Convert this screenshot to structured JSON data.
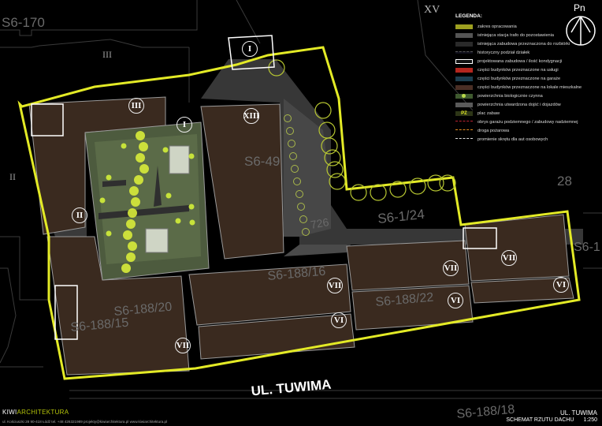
{
  "plan": {
    "street_name": "UL. TUWIMA",
    "parcel_labels": [
      "S6-170",
      "S6-49",
      "S6-1/24",
      "S6-188/16",
      "S6-188/20",
      "S6-188/15",
      "S6-188/22",
      "S6-188/18"
    ],
    "parcel_small_labels": [
      "28",
      "726",
      "S6-1"
    ],
    "roman_plain": [
      "III",
      "II",
      "XV"
    ],
    "roman_circled": [
      "I",
      "III",
      "I",
      "XIII",
      "II",
      "VII",
      "VII",
      "VI",
      "VII",
      "VI",
      "VI",
      "VII"
    ],
    "colors": {
      "scope": "#e3ea26",
      "residential": "#3a2a1f",
      "bio_active": "#54633d",
      "paved": "#6e6e6e",
      "existing_build": "#2e2e2e"
    }
  },
  "compass": {
    "label": "Pn"
  },
  "legend": {
    "title": "LEGENDA:",
    "items": [
      {
        "label": "zakres opracowania",
        "swatch": "#9ea020",
        "icon": ""
      },
      {
        "label": "istniejąca stacja trafo do pozostawienia",
        "swatch": "#555555",
        "icon": ""
      },
      {
        "label": "istniejąca zabudowa przeznaczona do rozbiórki",
        "swatch": "#2a2a2a",
        "icon": ""
      },
      {
        "label": "historyczny podział działek",
        "swatch": "#0f0f1a",
        "icon": "dashed-line"
      },
      {
        "label": "projektowana zabudowa / ilość kondygnacji",
        "swatch": "#111111",
        "icon": "outline"
      },
      {
        "label": "części budynków przeznaczone na usługi",
        "swatch": "#b3261e",
        "icon": ""
      },
      {
        "label": "części budynków przeznaczone na garaże",
        "swatch": "#1c3d4e",
        "icon": ""
      },
      {
        "label": "części budynków przeznaczone na lokale mieszkalne",
        "swatch": "#4a2f25",
        "icon": ""
      },
      {
        "label": "powierzchnia biologicznie czynna",
        "swatch": "#3f5a2f",
        "icon": "dot"
      },
      {
        "label": "powierzchnia utwardzona dojść i dojazdów",
        "swatch": "#5a5a5a",
        "icon": ""
      },
      {
        "label": "plac zabaw",
        "swatch": "#2d3516",
        "icon": "text-PZ"
      },
      {
        "label": "obrys garażu podziemnego / zabudowy nadziemnej",
        "swatch": "#111111",
        "icon": "red-dash"
      },
      {
        "label": "droga pożarowa",
        "swatch": "#111111",
        "icon": "orange-dash"
      },
      {
        "label": "promienie skrętu dla aut osobowych",
        "swatch": "#111111",
        "icon": "white-dash"
      }
    ],
    "pz_text": "PZ"
  },
  "footer": {
    "brand_a": "KIWI",
    "brand_b": "ARCHITEKTURA",
    "contact": "ul. Kościuszki 28 90-418 Łódź     tel. +48 426321989     projekty@kiwiarchitektura.pl     www.kiwiarchitektura.pl",
    "street": "UL. TUWIMA",
    "sheet_title": "SCHEMAT RZUTU DACHU",
    "scale": "1:250"
  }
}
